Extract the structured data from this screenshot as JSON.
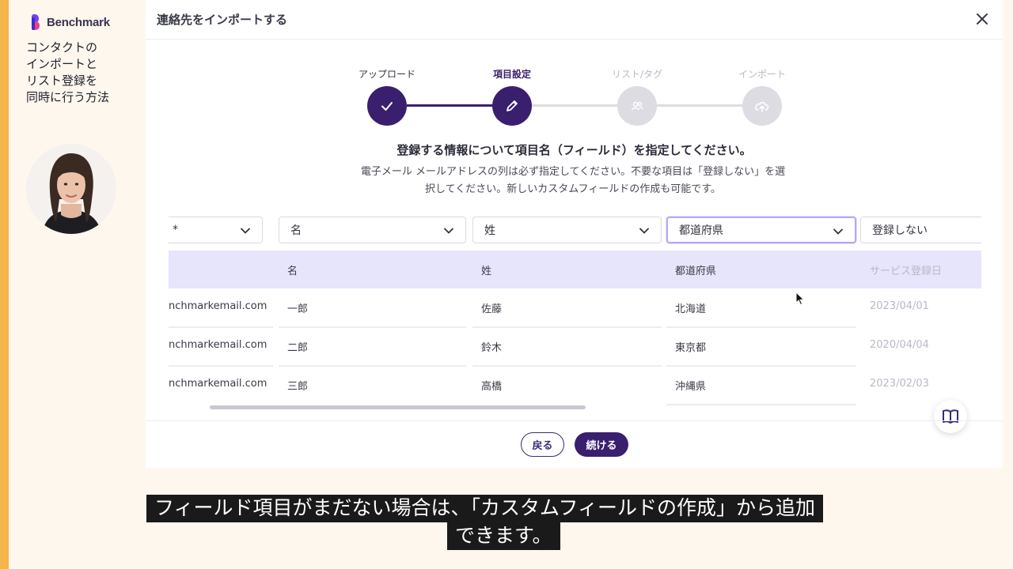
{
  "sidebar": {
    "brand": "Benchmark",
    "lesson_title": "コンタクトの\nインポートと\nリスト登録を\n同時に行う方法"
  },
  "modal": {
    "title": "連絡先をインポートする",
    "close_icon": "close-icon"
  },
  "stepper": {
    "steps": [
      {
        "label": "アップロード",
        "state": "done",
        "icon": "check-icon"
      },
      {
        "label": "項目設定",
        "state": "current",
        "icon": "pencil-icon"
      },
      {
        "label": "リスト/タグ",
        "state": "pending",
        "icon": "users-icon"
      },
      {
        "label": "インポート",
        "state": "pending",
        "icon": "cloud-upload-icon"
      }
    ],
    "colors": {
      "active": "#3a1f6e",
      "pending": "#dcdce2"
    }
  },
  "instructions": {
    "heading": "登録する情報について項目名（フィールド）を指定してください。",
    "body": "電子メール メールアドレスの列は必ず指定してください。不要な項目は「登録しない」を選択してください。新しいカスタムフィールドの作成も可能です。"
  },
  "mapping": {
    "selects": [
      "*",
      "名",
      "姓",
      "都道府県",
      "登録しない"
    ],
    "headers": [
      "",
      "名",
      "姓",
      "都道府県",
      "サービス登録日"
    ],
    "rows": [
      [
        "nchmarkemail.com",
        "一郎",
        "佐藤",
        "北海道",
        "2023/04/01"
      ],
      [
        "nchmarkemail.com",
        "二郎",
        "鈴木",
        "東京都",
        "2020/04/04"
      ],
      [
        "nchmarkemail.com",
        "三郎",
        "高橋",
        "沖縄県",
        "2023/02/03"
      ]
    ]
  },
  "footer": {
    "back_label": "戻る",
    "next_label": "続ける"
  },
  "help_icon": "book-icon",
  "captions": {
    "line1": "フィールド項目がまだない場合は、「カスタムフィールドの作成」から追加",
    "line2": "できます。"
  },
  "colors": {
    "accent_bar": "#f5b54a",
    "primary": "#3a1f6e",
    "header_row": "#e6e5fb"
  }
}
